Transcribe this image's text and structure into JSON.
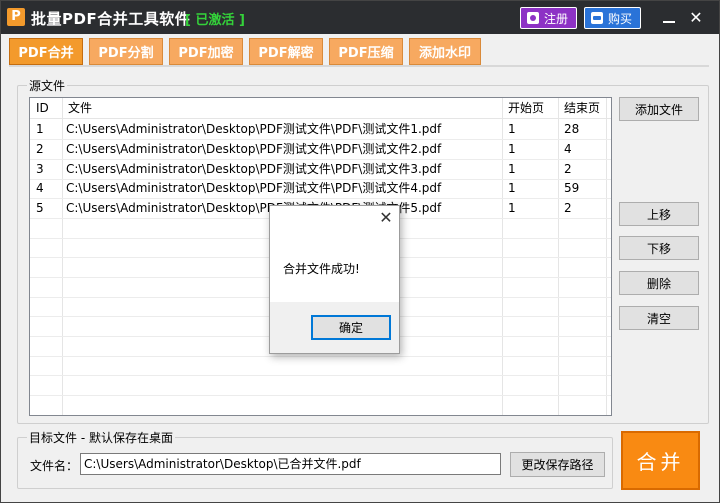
{
  "app": {
    "title": "批量PDF合并工具软件",
    "status": "[ 已激活 ]",
    "register_label": "注册",
    "buy_label": "购买",
    "minimize_label": "",
    "close_label": "✕"
  },
  "tabs": [
    {
      "label": "PDF合并",
      "active": true
    },
    {
      "label": "PDF分割",
      "active": false
    },
    {
      "label": "PDF加密",
      "active": false
    },
    {
      "label": "PDF解密",
      "active": false
    },
    {
      "label": "PDF压缩",
      "active": false
    },
    {
      "label": "添加水印",
      "active": false
    }
  ],
  "source": {
    "group_label": "源文件",
    "columns": [
      "ID",
      "文件",
      "开始页",
      "结束页"
    ],
    "rows": [
      {
        "id": "1",
        "file": "C:\\Users\\Administrator\\Desktop\\PDF测试文件\\PDF\\测试文件1.pdf",
        "start": "1",
        "end": "28"
      },
      {
        "id": "2",
        "file": "C:\\Users\\Administrator\\Desktop\\PDF测试文件\\PDF\\测试文件2.pdf",
        "start": "1",
        "end": "4"
      },
      {
        "id": "3",
        "file": "C:\\Users\\Administrator\\Desktop\\PDF测试文件\\PDF\\测试文件3.pdf",
        "start": "1",
        "end": "2"
      },
      {
        "id": "4",
        "file": "C:\\Users\\Administrator\\Desktop\\PDF测试文件\\PDF\\测试文件4.pdf",
        "start": "1",
        "end": "59"
      },
      {
        "id": "5",
        "file": "C:\\Users\\Administrator\\Desktop\\PDF测试文件\\PDF\\测试文件5.pdf",
        "start": "1",
        "end": "2"
      }
    ]
  },
  "side_buttons": {
    "add_file": "添加文件",
    "move_up": "上移",
    "move_down": "下移",
    "delete": "删除",
    "clear": "清空"
  },
  "target": {
    "group_label": "目标文件 - 默认保存在桌面",
    "filename_label": "文件名：",
    "filename_value": "C:\\Users\\Administrator\\Desktop\\已合并文件.pdf",
    "change_path_label": "更改保存路径"
  },
  "merge_label": "合并",
  "dialog": {
    "message": "合并文件成功!",
    "ok_label": "确定",
    "close_label": "✕"
  },
  "colors": {
    "accent": "#f39a2c",
    "titlebar": "#2b2d30",
    "status": "#34d23a",
    "register": "#8d32c5",
    "buy": "#2a73d8"
  }
}
